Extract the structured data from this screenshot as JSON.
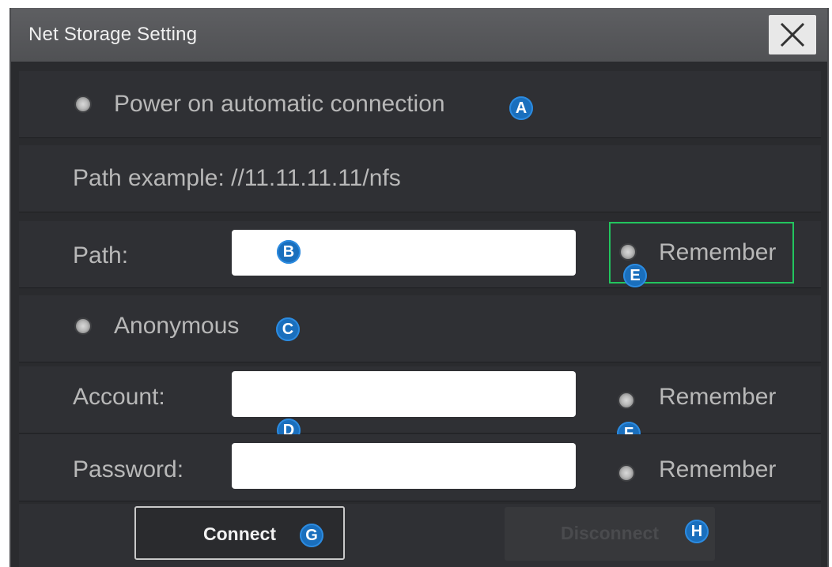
{
  "dialog": {
    "title": "Net Storage Setting",
    "close_icon": "close-x-icon"
  },
  "auto_connect": {
    "label": "Power on automatic connection",
    "badge": "A"
  },
  "path_example": {
    "text": "Path example: //11.11.11.11/nfs"
  },
  "path": {
    "label": "Path:",
    "value": "",
    "badge": "B",
    "remember_label": "Remember",
    "remember_badge": "E"
  },
  "anonymous": {
    "label": "Anonymous",
    "badge": "C"
  },
  "account": {
    "label": "Account:",
    "value": "",
    "badge": "D",
    "remember_label": "Remember",
    "remember_badge": "F"
  },
  "password": {
    "label": "Password:",
    "value": "",
    "remember_label": "Remember"
  },
  "buttons": {
    "connect_label": "Connect",
    "connect_badge": "G",
    "disconnect_label": "Disconnect",
    "disconnect_badge": "H"
  },
  "colors": {
    "badge": "#1a6fbd",
    "focus": "#22c55e",
    "panel": "#2f3034"
  }
}
